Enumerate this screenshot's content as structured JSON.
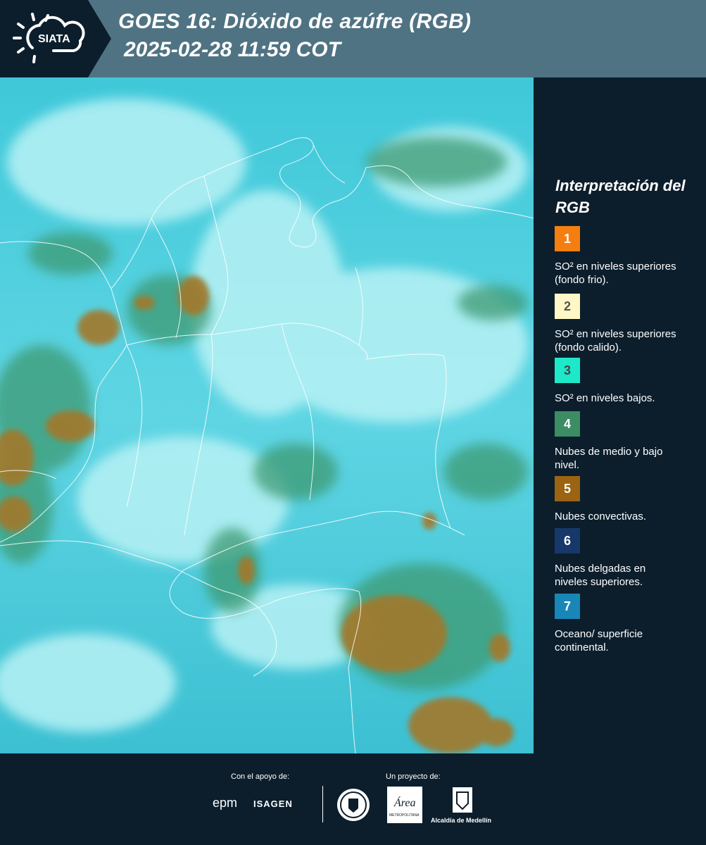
{
  "header": {
    "logo_text": "SIATA",
    "title_line1": "GOES 16: Dióxido de azúfre (RGB)",
    "title_line2": "2025-02-28 11:59 COT"
  },
  "legend": {
    "title": "Interpretación del RGB",
    "items": [
      {
        "number": "1",
        "color": "#f47f10",
        "text_color": "#ffffff",
        "label": "SO² en niveles superiores (fondo frio)."
      },
      {
        "number": "2",
        "color": "#fff7c6",
        "text_color": "#555555",
        "label": "SO² en niveles superiores (fondo calido)."
      },
      {
        "number": "3",
        "color": "#1de9c9",
        "text_color": "#444444",
        "label": "SO² en niveles bajos."
      },
      {
        "number": "4",
        "color": "#3c8c64",
        "text_color": "#ffffff",
        "label": "Nubes de medio y bajo nivel."
      },
      {
        "number": "5",
        "color": "#9a6412",
        "text_color": "#ffffff",
        "label": "Nubes convectivas."
      },
      {
        "number": "6",
        "color": "#17386a",
        "text_color": "#ffffff",
        "label": "Nubes delgadas en niveles superiores."
      },
      {
        "number": "7",
        "color": "#1986b8",
        "text_color": "#ffffff",
        "label": "Oceano/ superficie continental."
      }
    ]
  },
  "footer": {
    "support_label": "Con el apoyo de:",
    "project_label": "Un proyecto de:",
    "sponsor_epm": "epm",
    "sponsor_isagen": "ISAGEN",
    "metro_text": "Área",
    "metro_subtext": "METROPOLITANA",
    "alcaldia": "Alcaldía de Medellín"
  }
}
